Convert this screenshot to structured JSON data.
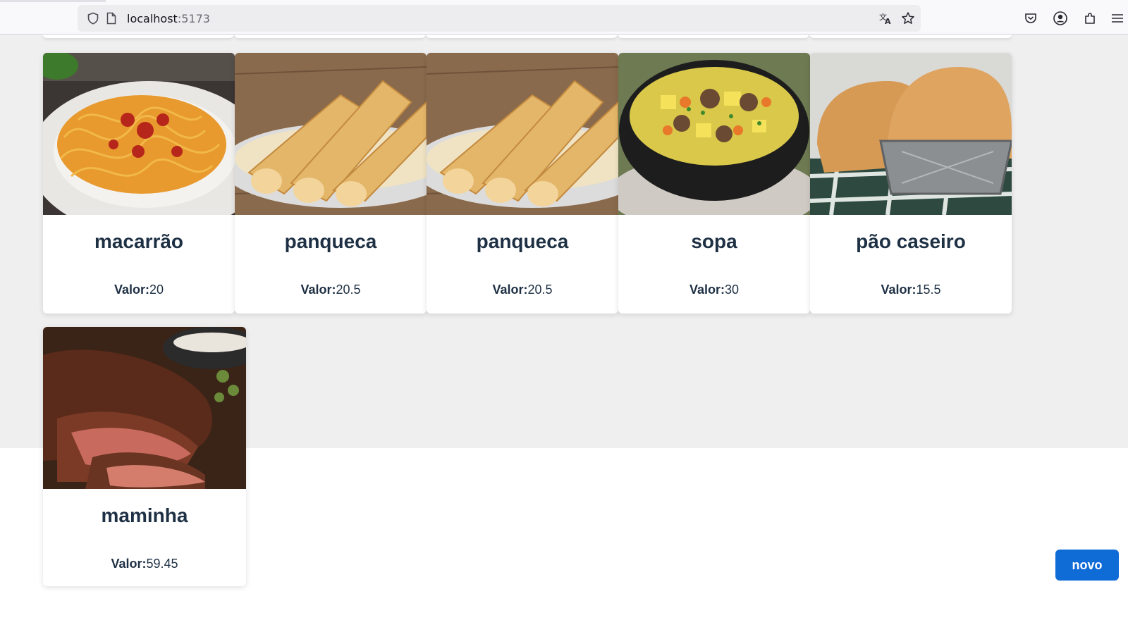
{
  "browser": {
    "url_host": "localhost",
    "url_port": ":5173"
  },
  "cards": [
    {
      "title": "macarrão",
      "price_label": "Valor:",
      "price": "20"
    },
    {
      "title": "panqueca",
      "price_label": "Valor:",
      "price": "20.5"
    },
    {
      "title": "panqueca",
      "price_label": "Valor:",
      "price": "20.5"
    },
    {
      "title": "sopa",
      "price_label": "Valor:",
      "price": "30"
    },
    {
      "title": "pão caseiro",
      "price_label": "Valor:",
      "price": "15.5"
    },
    {
      "title": "maminha",
      "price_label": "Valor:",
      "price": "59.45"
    }
  ],
  "actions": {
    "new_label": "novo"
  },
  "colors": {
    "button": "#0f6bd6",
    "card_text": "#1e3044",
    "page_bg": "#efefef"
  }
}
